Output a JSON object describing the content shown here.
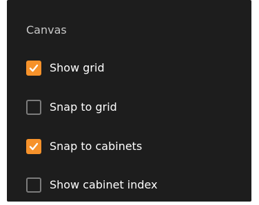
{
  "panel": {
    "section_title": "Canvas",
    "options": [
      {
        "label": "Show grid",
        "checked": true
      },
      {
        "label": "Snap to grid",
        "checked": false
      },
      {
        "label": "Snap to cabinets",
        "checked": true
      },
      {
        "label": "Show cabinet index",
        "checked": false
      }
    ]
  },
  "colors": {
    "panel_background": "#1d1d1d",
    "accent": "#f6922b",
    "checkbox_border": "#7c7c7c",
    "title_text": "#c8c8c8",
    "label_text": "#ffffff"
  },
  "icons": {
    "checkmark": "checkmark-icon"
  }
}
